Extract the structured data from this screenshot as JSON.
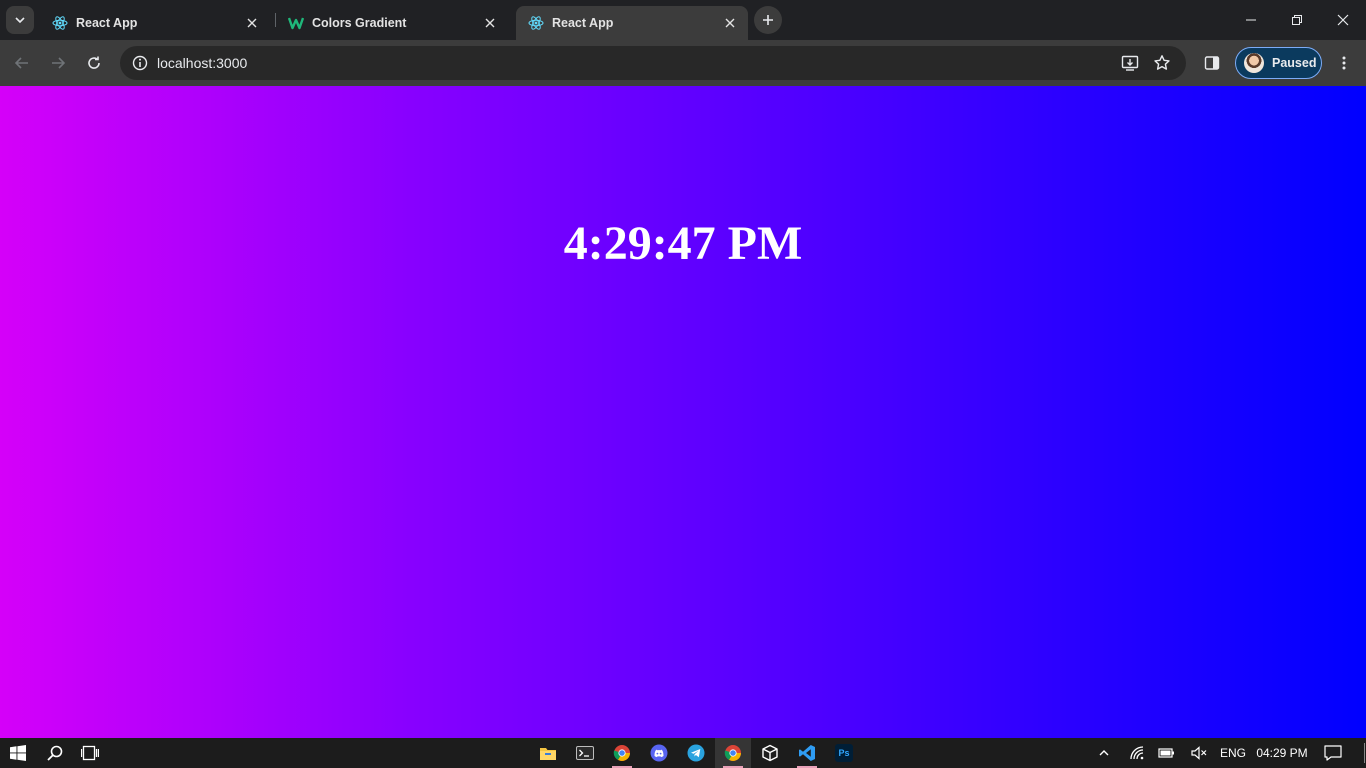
{
  "browser": {
    "tabs": [
      {
        "title": "React App",
        "favicon": "react-icon",
        "active": false
      },
      {
        "title": "Colors Gradient",
        "favicon": "w-logo-icon",
        "active": false
      },
      {
        "title": "React App",
        "favicon": "react-icon",
        "active": true
      }
    ],
    "address": {
      "url": "localhost:3000"
    },
    "profile": {
      "label": "Paused"
    }
  },
  "page": {
    "clock": "4:29:47 PM",
    "gradient": {
      "start": "#d500f9",
      "end": "#0000ff"
    }
  },
  "taskbar": {
    "apps": [
      "file-explorer-icon",
      "terminal-icon",
      "chrome-icon",
      "discord-icon",
      "telegram-icon",
      "chrome-icon",
      "virtualbox-icon",
      "vscode-icon",
      "photoshop-icon"
    ],
    "photoshop_label": "Ps",
    "language": "ENG",
    "time": "04:29 PM"
  }
}
